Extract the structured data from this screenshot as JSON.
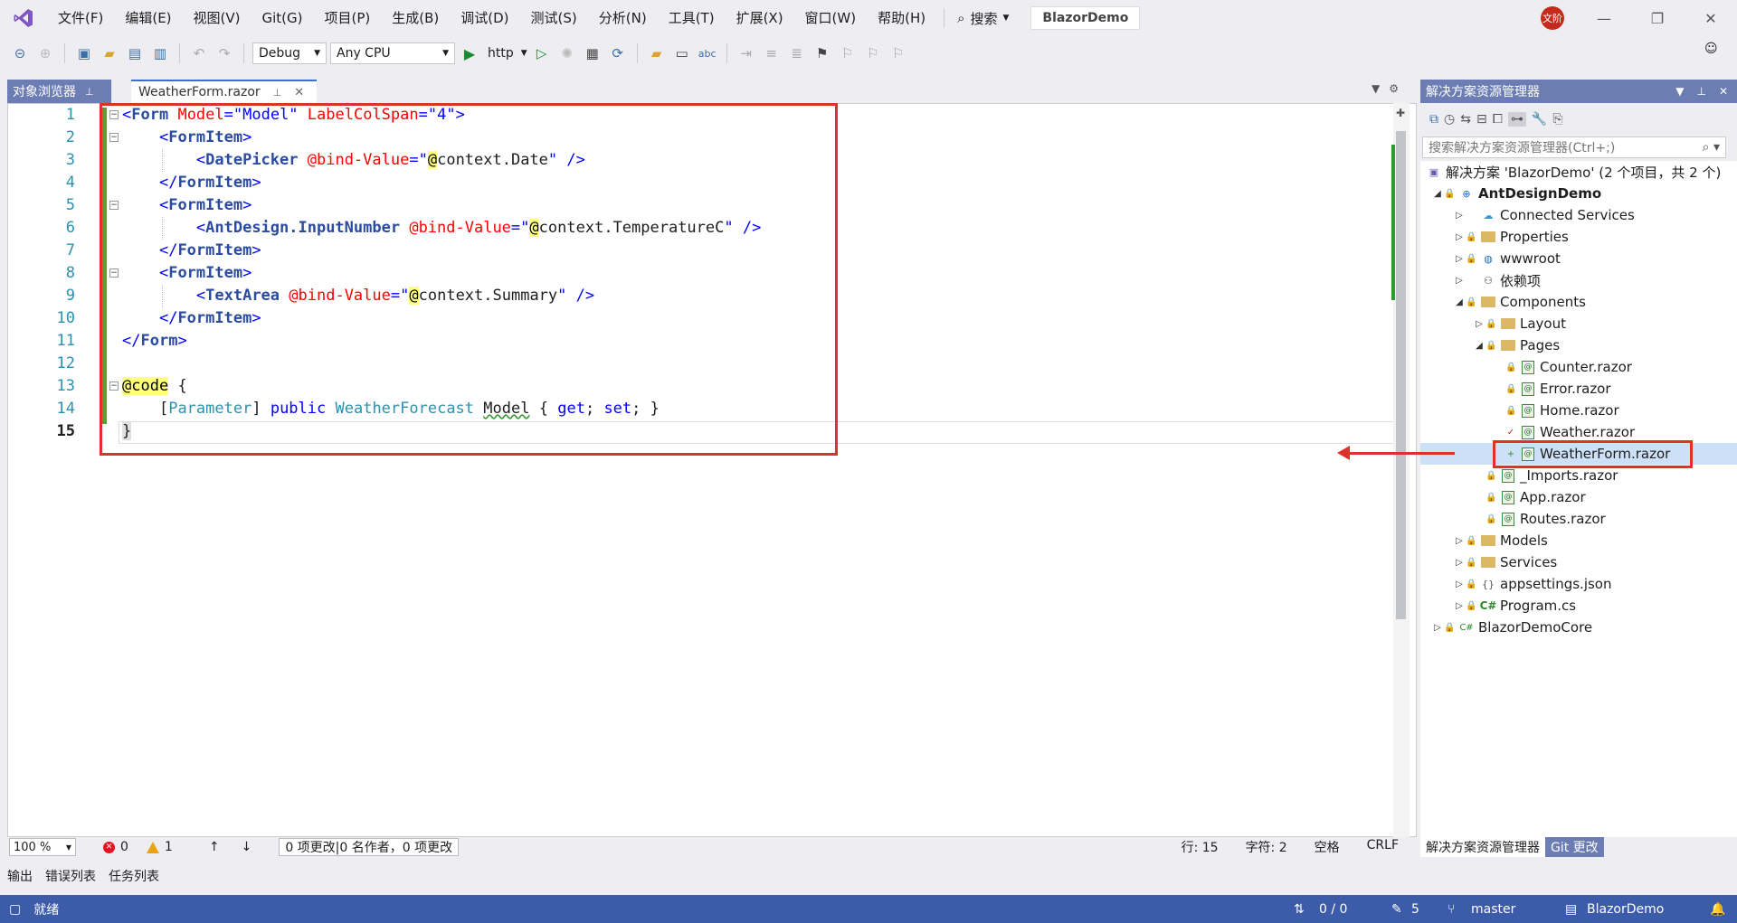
{
  "menubar": {
    "items": [
      "文件(F)",
      "编辑(E)",
      "视图(V)",
      "Git(G)",
      "项目(P)",
      "生成(B)",
      "调试(D)",
      "测试(S)",
      "分析(N)",
      "工具(T)",
      "扩展(X)",
      "窗口(W)",
      "帮助(H)"
    ],
    "search_label": "搜索",
    "solution_name": "BlazorDemo",
    "user_initials": "文阶"
  },
  "toolbar": {
    "config": "Debug",
    "platform": "Any CPU",
    "run_target": "http"
  },
  "tabs": {
    "object_browser": "对象浏览器",
    "active_file": "WeatherForm.razor"
  },
  "editor": {
    "line_numbers": [
      "1",
      "2",
      "3",
      "4",
      "5",
      "6",
      "7",
      "8",
      "9",
      "10",
      "11",
      "12",
      "13",
      "14",
      "15"
    ],
    "zoom": "100 %",
    "errors": "0",
    "warnings": "1",
    "changes_text": "0 项更改|0 名作者，0 项更改",
    "line": "行: 15",
    "char": "字符: 2",
    "indent": "空格",
    "eol": "CRLF"
  },
  "bottom_tabs": [
    "输出",
    "错误列表",
    "任务列表"
  ],
  "statusbar": {
    "ready": "就绪",
    "sync": "0 / 0",
    "pencil_count": "5",
    "branch": "master",
    "repo": "BlazorDemo"
  },
  "solution_explorer": {
    "title": "解决方案资源管理器",
    "search_placeholder": "搜索解决方案资源管理器(Ctrl+;)",
    "tree": [
      {
        "label": "解决方案 'BlazorDemo' (2 个项目，共 2 个)",
        "indent": 0
      },
      {
        "label": "AntDesignDemo",
        "indent": 1
      },
      {
        "label": "Connected Services",
        "indent": 2
      },
      {
        "label": "Properties",
        "indent": 2
      },
      {
        "label": "wwwroot",
        "indent": 2
      },
      {
        "label": "依赖项",
        "indent": 2
      },
      {
        "label": "Components",
        "indent": 2
      },
      {
        "label": "Layout",
        "indent": 3
      },
      {
        "label": "Pages",
        "indent": 3
      },
      {
        "label": "Counter.razor",
        "indent": 4
      },
      {
        "label": "Error.razor",
        "indent": 4
      },
      {
        "label": "Home.razor",
        "indent": 4
      },
      {
        "label": "Weather.razor",
        "indent": 4
      },
      {
        "label": "WeatherForm.razor",
        "indent": 4
      },
      {
        "label": "_Imports.razor",
        "indent": 3
      },
      {
        "label": "App.razor",
        "indent": 3
      },
      {
        "label": "Routes.razor",
        "indent": 3
      },
      {
        "label": "Models",
        "indent": 2
      },
      {
        "label": "Services",
        "indent": 2
      },
      {
        "label": "appsettings.json",
        "indent": 2
      },
      {
        "label": "Program.cs",
        "indent": 2
      },
      {
        "label": "BlazorDemoCore",
        "indent": 1
      }
    ],
    "bottom_tabs": [
      "解决方案资源管理器",
      "Git 更改"
    ]
  },
  "colors": {
    "accent": "#3c5ba8",
    "panel_header": "#6b7db3",
    "annotation_red": "#e0302b"
  }
}
